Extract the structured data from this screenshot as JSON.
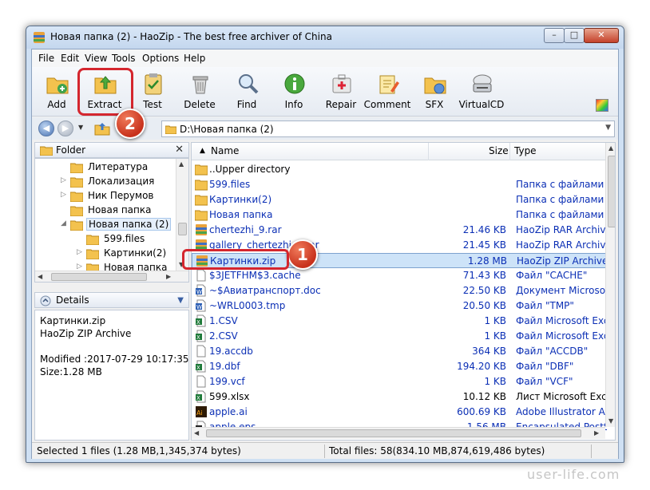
{
  "window": {
    "title": "Новая папка (2) - HaoZip - The best free archiver of China",
    "controls": {
      "minimize": "–",
      "maximize": "□",
      "close": "✕"
    }
  },
  "menu": [
    {
      "label": "File"
    },
    {
      "label": "Edit"
    },
    {
      "label": "View"
    },
    {
      "label": "Tools"
    },
    {
      "label": "Options"
    },
    {
      "label": "Help"
    }
  ],
  "toolbar": {
    "buttons": [
      {
        "label": "Add",
        "icon": "add-folder-icon"
      },
      {
        "label": "Extract",
        "icon": "extract-folder-icon"
      },
      {
        "label": "Test",
        "icon": "test-clipboard-icon"
      },
      {
        "label": "Delete",
        "icon": "trash-icon"
      },
      {
        "label": "Find",
        "icon": "magnifier-icon"
      },
      {
        "label": "Info",
        "icon": "info-icon"
      },
      {
        "label": "Repair",
        "icon": "first-aid-icon"
      },
      {
        "label": "Comment",
        "icon": "comment-pencil-icon"
      },
      {
        "label": "SFX",
        "icon": "sfx-folder-icon"
      },
      {
        "label": "VirtualCD",
        "icon": "cd-drive-icon"
      }
    ],
    "palette_icon": "skin-palette-icon"
  },
  "annotations": {
    "bubble1": "1",
    "bubble2": "2",
    "color": "#d4262e"
  },
  "address": {
    "path": "D:\\Новая папка (2)"
  },
  "folder_panel": {
    "title": "Folder",
    "close": "✕",
    "tree": [
      {
        "label": "Литература",
        "level": 1,
        "expander": ""
      },
      {
        "label": "Локализация",
        "level": 1,
        "expander": "▷"
      },
      {
        "label": "Ник Перумов",
        "level": 1,
        "expander": "▷"
      },
      {
        "label": "Новая папка",
        "level": 1,
        "expander": ""
      },
      {
        "label": "Новая папка (2)",
        "level": 1,
        "expander": "◢",
        "selected": true
      },
      {
        "label": "599.files",
        "level": 2,
        "expander": ""
      },
      {
        "label": "Картинки(2)",
        "level": 2,
        "expander": "▷"
      },
      {
        "label": "Новая папка",
        "level": 2,
        "expander": "▷"
      }
    ]
  },
  "details_panel": {
    "title": "Details",
    "lines": [
      "Картинки.zip",
      "HaoZip ZIP Archive",
      "",
      "Modified :2017-07-29 10:17:35",
      "Size:1.28 MB"
    ]
  },
  "file_list": {
    "columns": {
      "name": "Name",
      "size": "Size",
      "type": "Type"
    },
    "rows": [
      {
        "name": "..Upper directory",
        "size": "",
        "type": "",
        "icon": "folder-icon",
        "dark": true
      },
      {
        "name": "599.files",
        "size": "",
        "type": "Папка с файлами",
        "icon": "folder-icon"
      },
      {
        "name": "Картинки(2)",
        "size": "",
        "type": "Папка с файлами",
        "icon": "folder-icon"
      },
      {
        "name": "Новая папка",
        "size": "",
        "type": "Папка с файлами",
        "icon": "folder-icon"
      },
      {
        "name": "chertezhi_9.rar",
        "size": "21.46 KB",
        "type": "HaoZip RAR Archive",
        "icon": "archive-icon"
      },
      {
        "name": "gallery_chertezhi_1.rar",
        "size": "21.45 KB",
        "type": "HaoZip RAR Archive",
        "icon": "archive-icon"
      },
      {
        "name": "Картинки.zip",
        "size": "1.28 MB",
        "type": "HaoZip ZIP Archive",
        "icon": "archive-icon",
        "selected": true
      },
      {
        "name": "$3JETFHM$3.cache",
        "size": "71.43 KB",
        "type": "Файл \"CACHE\"",
        "icon": "blank-file-icon"
      },
      {
        "name": "~$Авиатранспорт.doc",
        "size": "22.50 KB",
        "type": "Документ Microsoft W",
        "icon": "word-doc-icon"
      },
      {
        "name": "~WRL0003.tmp",
        "size": "20.50 KB",
        "type": "Файл \"TMP\"",
        "icon": "word-doc-icon"
      },
      {
        "name": "1.CSV",
        "size": "1 KB",
        "type": "Файл Microsoft Excel",
        "icon": "excel-icon"
      },
      {
        "name": "2.CSV",
        "size": "1 KB",
        "type": "Файл Microsoft Excel",
        "icon": "excel-icon"
      },
      {
        "name": "19.accdb",
        "size": "364 KB",
        "type": "Файл \"ACCDB\"",
        "icon": "blank-file-icon"
      },
      {
        "name": "19.dbf",
        "size": "194.20 KB",
        "type": "Файл \"DBF\"",
        "icon": "excel-icon"
      },
      {
        "name": "199.vcf",
        "size": "1 KB",
        "type": "Файл \"VCF\"",
        "icon": "blank-file-icon"
      },
      {
        "name": "599.xlsx",
        "size": "10.12 KB",
        "type": "Лист Microsoft Excel",
        "icon": "excel-icon",
        "dark": true
      },
      {
        "name": "apple.ai",
        "size": "600.69 KB",
        "type": "Adobe Illustrator Artw",
        "icon": "illustrator-icon"
      },
      {
        "name": "apple.eps",
        "size": "1.56 MB",
        "type": "Encapsulated PostScri",
        "icon": "eps-icon"
      }
    ]
  },
  "status": {
    "selected": "Selected 1 files (1.28 MB,1,345,374 bytes)",
    "total": "Total files: 58(834.10 MB,874,619,486 bytes)"
  },
  "watermark": "user-life.com"
}
